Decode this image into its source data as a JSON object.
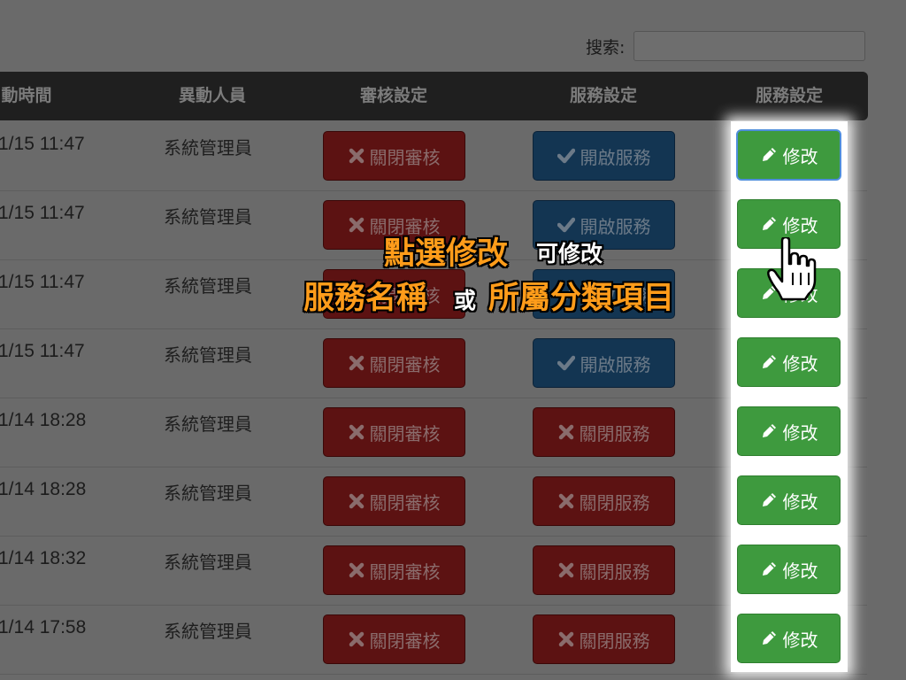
{
  "search": {
    "label": "搜索:",
    "value": ""
  },
  "header": {
    "time": "動時間",
    "user": "異動人員",
    "review": "審核設定",
    "service": "服務設定",
    "edit": "服務設定"
  },
  "rows": [
    {
      "time": "1/15 11:47",
      "user": "系統管理員",
      "review": "關閉審核",
      "service": "開啟服務",
      "service_state": "open",
      "edit": "修改"
    },
    {
      "time": "1/15 11:47",
      "user": "系統管理員",
      "review": "關閉審核",
      "service": "開啟服務",
      "service_state": "open",
      "edit": "修改"
    },
    {
      "time": "1/15 11:47",
      "user": "系統管理員",
      "review": "關閉審核",
      "service": "開啟服務",
      "service_state": "open",
      "edit": "修改"
    },
    {
      "time": "1/15 11:47",
      "user": "系統管理員",
      "review": "關閉審核",
      "service": "開啟服務",
      "service_state": "open",
      "edit": "修改"
    },
    {
      "time": "1/14 18:28",
      "user": "系統管理員",
      "review": "關閉審核",
      "service": "關閉服務",
      "service_state": "closed",
      "edit": "修改"
    },
    {
      "time": "1/14 18:28",
      "user": "系統管理員",
      "review": "關閉審核",
      "service": "關閉服務",
      "service_state": "closed",
      "edit": "修改"
    },
    {
      "time": "1/14 18:32",
      "user": "系統管理員",
      "review": "關閉審核",
      "service": "關閉服務",
      "service_state": "closed",
      "edit": "修改"
    },
    {
      "time": "1/14 17:58",
      "user": "系統管理員",
      "review": "關閉審核",
      "service": "關閉服務",
      "service_state": "closed",
      "edit": "修改"
    }
  ],
  "annotation": {
    "line1_big": "點選修改",
    "line1_small": "可修改",
    "line2_big_a": "服務名稱",
    "line2_small": "或",
    "line2_big_b": "所屬分類項目"
  },
  "colors": {
    "edit_green": "#3e9a3e",
    "close_red": "#5c1212",
    "open_blue": "#133552",
    "annotation_orange": "#ff9c1a"
  },
  "icons": {
    "review": "close-icon",
    "service_open": "check-icon",
    "service_closed": "close-icon",
    "edit": "pencil-icon",
    "cursor": "hand-pointer-icon"
  }
}
